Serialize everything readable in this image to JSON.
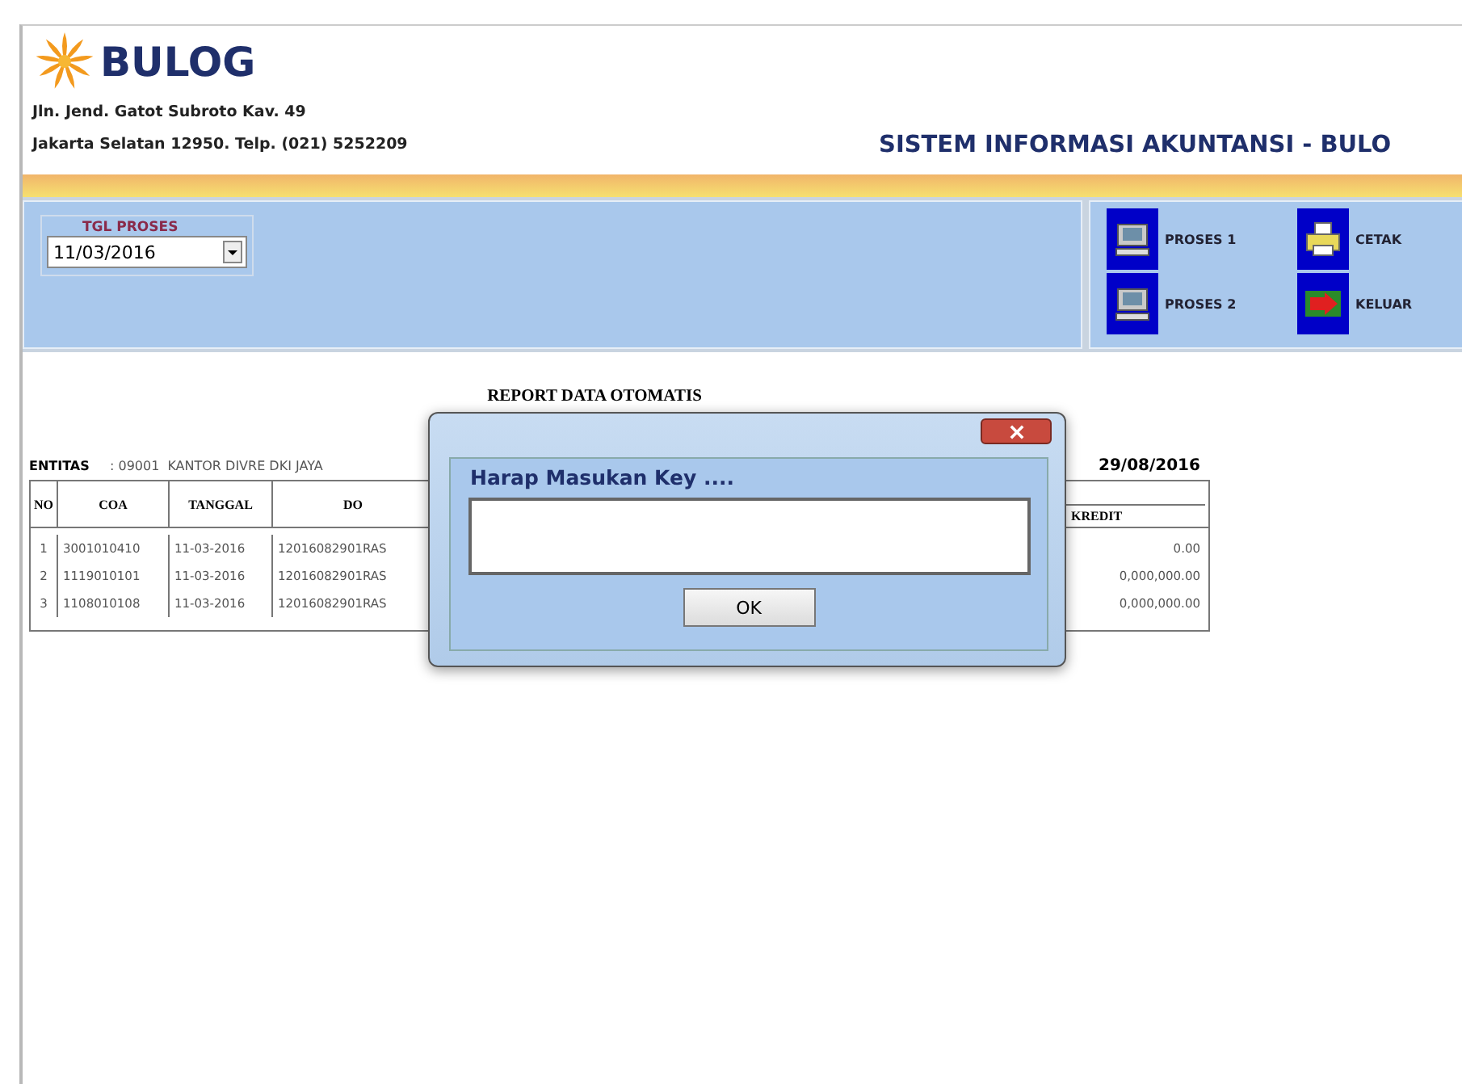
{
  "header": {
    "logo_text": "BULOG",
    "address_lines": [
      "Jln. Jend. Gatot Subroto Kav. 49",
      "Jakarta Selatan 12950. Telp. (021) 5252209"
    ],
    "system_title": "SISTEM INFORMASI AKUNTANSI - BULO"
  },
  "date_filter": {
    "label": "TGL PROSES",
    "value": "11/03/2016"
  },
  "actions": [
    {
      "label": "PROSES 1",
      "kind": "computer"
    },
    {
      "label": "CETAK",
      "kind": "printer"
    },
    {
      "label": "PROSES 2",
      "kind": "computer"
    },
    {
      "label": "KELUAR",
      "kind": "exit"
    }
  ],
  "report": {
    "title": "REPORT DATA OTOMATIS",
    "entity_label": "ENTITAS",
    "entity_code": ": 09001",
    "entity_name": "KANTOR DIVRE DKI JAYA",
    "date": "29/08/2016",
    "columns": [
      "NO",
      "COA",
      "TANGGAL",
      "DO",
      "KREDIT"
    ],
    "rows": [
      {
        "no": "1",
        "coa": "3001010410",
        "tanggal": "11-03-2016",
        "do": "12016082901RAS",
        "kredit": "0.00"
      },
      {
        "no": "2",
        "coa": "1119010101",
        "tanggal": "11-03-2016",
        "do": "12016082901RAS",
        "kredit": "0,000,000.00"
      },
      {
        "no": "3",
        "coa": "1108010108",
        "tanggal": "11-03-2016",
        "do": "12016082901RAS",
        "kredit": "0,000,000.00"
      }
    ]
  },
  "dialog": {
    "prompt": "Harap Masukan Key ....",
    "button": "OK"
  }
}
